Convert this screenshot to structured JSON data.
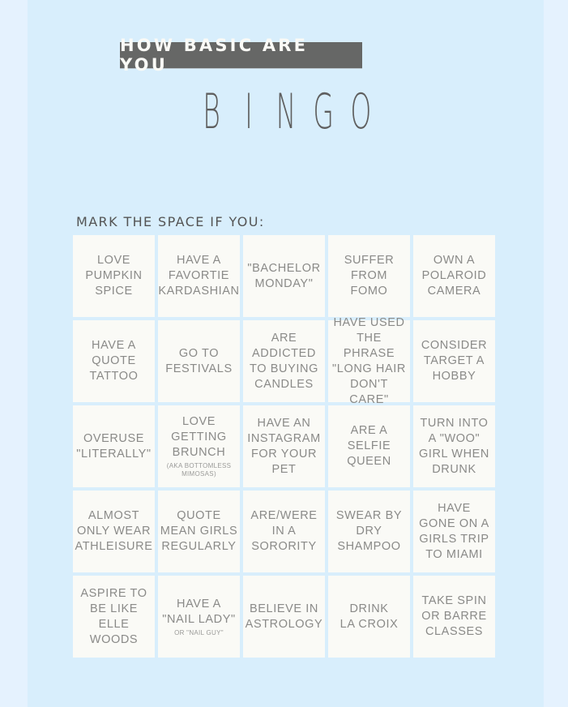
{
  "header": {
    "subtitle": "HOW BASIC ARE YOU",
    "title_letters": [
      "B",
      "I",
      "N",
      "G",
      "O"
    ]
  },
  "instruction": "MARK THE SPACE IF YOU:",
  "colors": {
    "outer_background": "#e5f2fe",
    "card_background": "#d8eefc",
    "header_bar": "#666766",
    "cell_background": "#fafaf6",
    "cell_text": "#8a8a88"
  },
  "grid": {
    "rows": 5,
    "columns": 5,
    "cells": [
      {
        "text": "LOVE\nPUMPKIN\nSPICE",
        "note": ""
      },
      {
        "text": "HAVE A\nFAVORTIE\nKARDASHIAN",
        "note": ""
      },
      {
        "text": "\"BACHELOR\nMONDAY\"",
        "note": ""
      },
      {
        "text": "SUFFER\nFROM\nFOMO",
        "note": ""
      },
      {
        "text": "OWN A\nPOLAROID\nCAMERA",
        "note": ""
      },
      {
        "text": "HAVE A\nQUOTE\nTATTOO",
        "note": ""
      },
      {
        "text": "GO TO\nFESTIVALS",
        "note": ""
      },
      {
        "text": "ARE\nADDICTED\nTO BUYING\nCANDLES",
        "note": ""
      },
      {
        "text": "HAVE USED\nTHE PHRASE\n\"LONG HAIR\nDON'T CARE\"",
        "note": ""
      },
      {
        "text": "CONSIDER\nTARGET A\nHOBBY",
        "note": ""
      },
      {
        "text": "OVERUSE\n\"LITERALLY\"",
        "note": ""
      },
      {
        "text": "LOVE\nGETTING\nBRUNCH",
        "note": "(AKA BOTTOMLESS\nMIMOSAS)"
      },
      {
        "text": "HAVE AN\nINSTAGRAM\nFOR YOUR\nPET",
        "note": ""
      },
      {
        "text": "ARE A\nSELFIE\nQUEEN",
        "note": ""
      },
      {
        "text": "TURN INTO\nA \"WOO\"\nGIRL WHEN\nDRUNK",
        "note": ""
      },
      {
        "text": "ALMOST\nONLY WEAR\nATHLEISURE",
        "note": ""
      },
      {
        "text": "QUOTE\nMEAN GIRLS\nREGULARLY",
        "note": ""
      },
      {
        "text": "ARE/WERE\nIN A\nSORORITY",
        "note": ""
      },
      {
        "text": "SWEAR BY\nDRY\nSHAMPOO",
        "note": ""
      },
      {
        "text": "HAVE\nGONE ON A\nGIRLS TRIP\nTO MIAMI",
        "note": ""
      },
      {
        "text": "ASPIRE TO\nBE LIKE\nELLE WOODS",
        "note": ""
      },
      {
        "text": "HAVE A\n\"NAIL LADY\"",
        "note": "OR \"NAIL GUY\""
      },
      {
        "text": "BELIEVE IN\nASTROLOGY",
        "note": ""
      },
      {
        "text": "DRINK\nLA CROIX",
        "note": ""
      },
      {
        "text": "TAKE SPIN\nOR BARRE\nCLASSES",
        "note": ""
      }
    ]
  }
}
